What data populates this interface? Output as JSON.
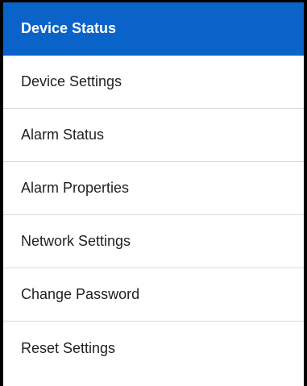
{
  "menu": {
    "items": [
      {
        "label": "Device Status",
        "active": true
      },
      {
        "label": "Device Settings",
        "active": false
      },
      {
        "label": "Alarm Status",
        "active": false
      },
      {
        "label": "Alarm Properties",
        "active": false
      },
      {
        "label": "Network Settings",
        "active": false
      },
      {
        "label": "Change Password",
        "active": false
      },
      {
        "label": "Reset Settings",
        "active": false
      }
    ]
  },
  "colors": {
    "active_background": "#0a63c9",
    "active_text": "#ffffff",
    "text": "#1f1f1f",
    "border": "#000000",
    "divider": "#d9d9d9"
  }
}
